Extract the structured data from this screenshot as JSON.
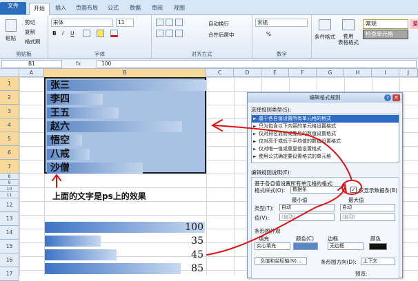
{
  "ribbon_tabs": [
    "文件",
    "开始",
    "插入",
    "页面布局",
    "公式",
    "数据",
    "审阅",
    "视图"
  ],
  "clipboard": {
    "paste": "粘贴",
    "cut": "剪切",
    "copy": "复制",
    "format_painter": "格式刷",
    "group": "剪贴板"
  },
  "font": {
    "group": "字体",
    "size": "11",
    "bold": "B",
    "italic": "I",
    "underline": "U",
    "name": "宋体"
  },
  "alignment": {
    "group": "对齐方式",
    "wrap": "自动换行",
    "merge": "合并后居中"
  },
  "number": {
    "group": "数字",
    "format": "常规",
    "percent": "%"
  },
  "styles": {
    "conditional": "条件格式",
    "table_format": "套用\n表格格式",
    "normal": "常规",
    "check_cell": "检查单元格",
    "bad": "差"
  },
  "formula_bar": {
    "cell": "B1",
    "fx": "fx",
    "value": "100"
  },
  "columns": [
    "A",
    "B",
    "C",
    "D",
    "E",
    "F",
    "G",
    "H",
    "I",
    "J"
  ],
  "rows": [
    "1",
    "2",
    "3",
    "4",
    "5",
    "6",
    "7",
    "8",
    "9",
    "10",
    "11",
    "12",
    "13",
    "14",
    "15",
    "16",
    "17"
  ],
  "names": [
    "张三",
    "李四",
    "王五",
    "赵六",
    "悟空",
    "八戒",
    "沙僧"
  ],
  "name_bar_fractions": [
    1.0,
    0.35,
    0.45,
    0.85,
    0.22,
    0.27,
    0.6
  ],
  "numbers": [
    {
      "value": "100",
      "fraction": 1.0
    },
    {
      "value": "35",
      "fraction": 0.35
    },
    {
      "value": "45",
      "fraction": 0.45
    },
    {
      "value": "85",
      "fraction": 0.85
    }
  ],
  "caption": "上面的文字是ps上的效果",
  "dialog": {
    "title": "编辑格式规则",
    "help": "?",
    "close": "✕",
    "rule_type_label": "选择规则类型(S):",
    "rule_types": [
      "基于各自值设置所有单元格的格式",
      "只为包含以下内容的单元格设置格式",
      "仅对排名靠前或靠后的数值设置格式",
      "仅对高于或低于平均值的数值设置格式",
      "仅对唯一值或重复值设置格式",
      "使用公式确定要设置格式的单元格"
    ],
    "desc_label": "编辑规则说明(E):",
    "desc_heading": "基于各自值设置所有单元格的格式:",
    "format_style_label": "格式样式(O):",
    "format_style": "数据条",
    "show_bar_only": "仅显示数据条(B)",
    "min_label": "最小值",
    "max_label": "最大值",
    "type_label": "类型(T):",
    "type_min": "自动",
    "type_max": "自动",
    "value_label": "值(V):",
    "value_min": "(自动)",
    "value_max": "(自动)",
    "bar_appearance": "条形图外观",
    "fill_label": "填充",
    "fill": "实心填充",
    "color_label": "颜色(C)",
    "border_label": "边框",
    "border": "无边框",
    "color2_label": "颜色",
    "neg_button": "负值和坐标轴(N)...",
    "direction_label": "条形图方向(D):",
    "direction": "上下文",
    "preview": "预览:"
  }
}
